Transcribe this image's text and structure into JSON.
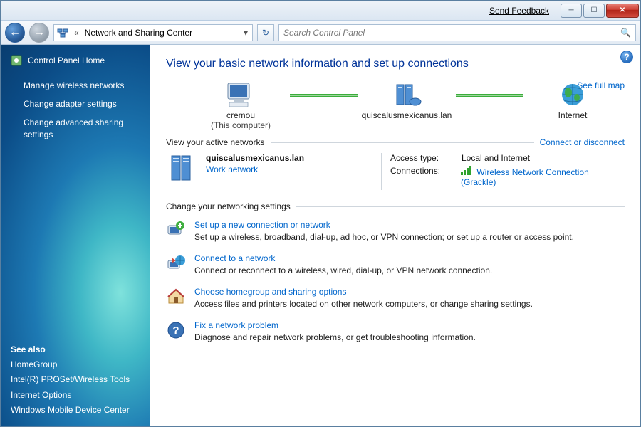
{
  "titlebar": {
    "feedback": "Send Feedback"
  },
  "nav": {
    "breadcrumb_prefix": "«",
    "breadcrumb": "Network and Sharing Center",
    "search_placeholder": "Search Control Panel"
  },
  "sidebar": {
    "home_label": "Control Panel Home",
    "links": [
      "Manage wireless networks",
      "Change adapter settings",
      "Change advanced sharing settings"
    ],
    "see_also_label": "See also",
    "see_also": [
      "HomeGroup",
      "Intel(R) PROSet/Wireless Tools",
      "Internet Options",
      "Windows Mobile Device Center"
    ]
  },
  "main": {
    "title": "View your basic network information and set up connections",
    "full_map": "See full map",
    "map": {
      "node1": "cremou",
      "node1_sub": "(This computer)",
      "node2": "quiscalusmexicanus.lan",
      "node3": "Internet"
    },
    "active_label": "View your active networks",
    "connect_link": "Connect or disconnect",
    "active": {
      "name": "quiscalusmexicanus.lan",
      "type": "Work network",
      "access_key": "Access type:",
      "access_val": "Local and Internet",
      "conn_key": "Connections:",
      "conn_val": "Wireless Network Connection (Grackle)"
    },
    "settings_label": "Change your networking settings",
    "settings": [
      {
        "title": "Set up a new connection or network",
        "desc": "Set up a wireless, broadband, dial-up, ad hoc, or VPN connection; or set up a router or access point."
      },
      {
        "title": "Connect to a network",
        "desc": "Connect or reconnect to a wireless, wired, dial-up, or VPN network connection."
      },
      {
        "title": "Choose homegroup and sharing options",
        "desc": "Access files and printers located on other network computers, or change sharing settings."
      },
      {
        "title": "Fix a network problem",
        "desc": "Diagnose and repair network problems, or get troubleshooting information."
      }
    ]
  }
}
